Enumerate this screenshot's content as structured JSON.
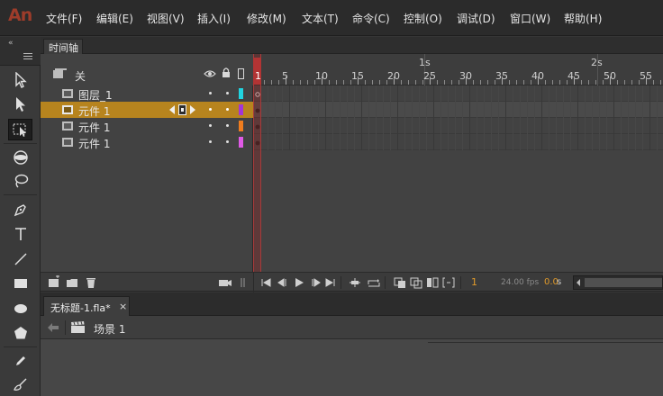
{
  "app": {
    "logo": "An"
  },
  "menu": {
    "items": [
      "文件(F)",
      "编辑(E)",
      "视图(V)",
      "插入(I)",
      "修改(M)",
      "文本(T)",
      "命令(C)",
      "控制(O)",
      "调试(D)",
      "窗口(W)",
      "帮助(H)"
    ]
  },
  "toolbar": {
    "collapse_glyph": "«",
    "tools": [
      "selection-tool",
      "subselection-tool",
      "free-transform-tool",
      "3d-rotation-tool",
      "lasso-tool",
      "pen-tool",
      "text-tool",
      "line-tool",
      "rectangle-tool",
      "oval-tool",
      "polystar-tool",
      "pencil-tool",
      "brush-tool"
    ],
    "active_tool": "free-transform-tool"
  },
  "timeline": {
    "tab_label": "时间轴",
    "header_label": "关",
    "ruler": {
      "frame_numbers": [
        "1",
        "5",
        "10",
        "15",
        "20",
        "25",
        "30",
        "35",
        "40",
        "45",
        "50",
        "55"
      ],
      "seconds": [
        "1s",
        "2s"
      ]
    },
    "layers": [
      {
        "name": "图层_1",
        "color": "#21d4e0",
        "selected": false
      },
      {
        "name": "元件 1",
        "color": "#a235d8",
        "selected": true
      },
      {
        "name": "元件 1",
        "color": "#f07d1e",
        "selected": false
      },
      {
        "name": "元件 1",
        "color": "#e05ae6",
        "selected": false
      }
    ],
    "playhead_frame": "1",
    "current_frame": "1",
    "fps": "24.00 fps",
    "time": "0.0",
    "time_unit": "s"
  },
  "document": {
    "tab_title": "无标题-1.fla*",
    "close_glyph": "×",
    "scene_label": "场景 1"
  },
  "colors": {
    "accent": "#b7841e",
    "playhead": "#b23434",
    "logo": "#9e3c2a"
  }
}
